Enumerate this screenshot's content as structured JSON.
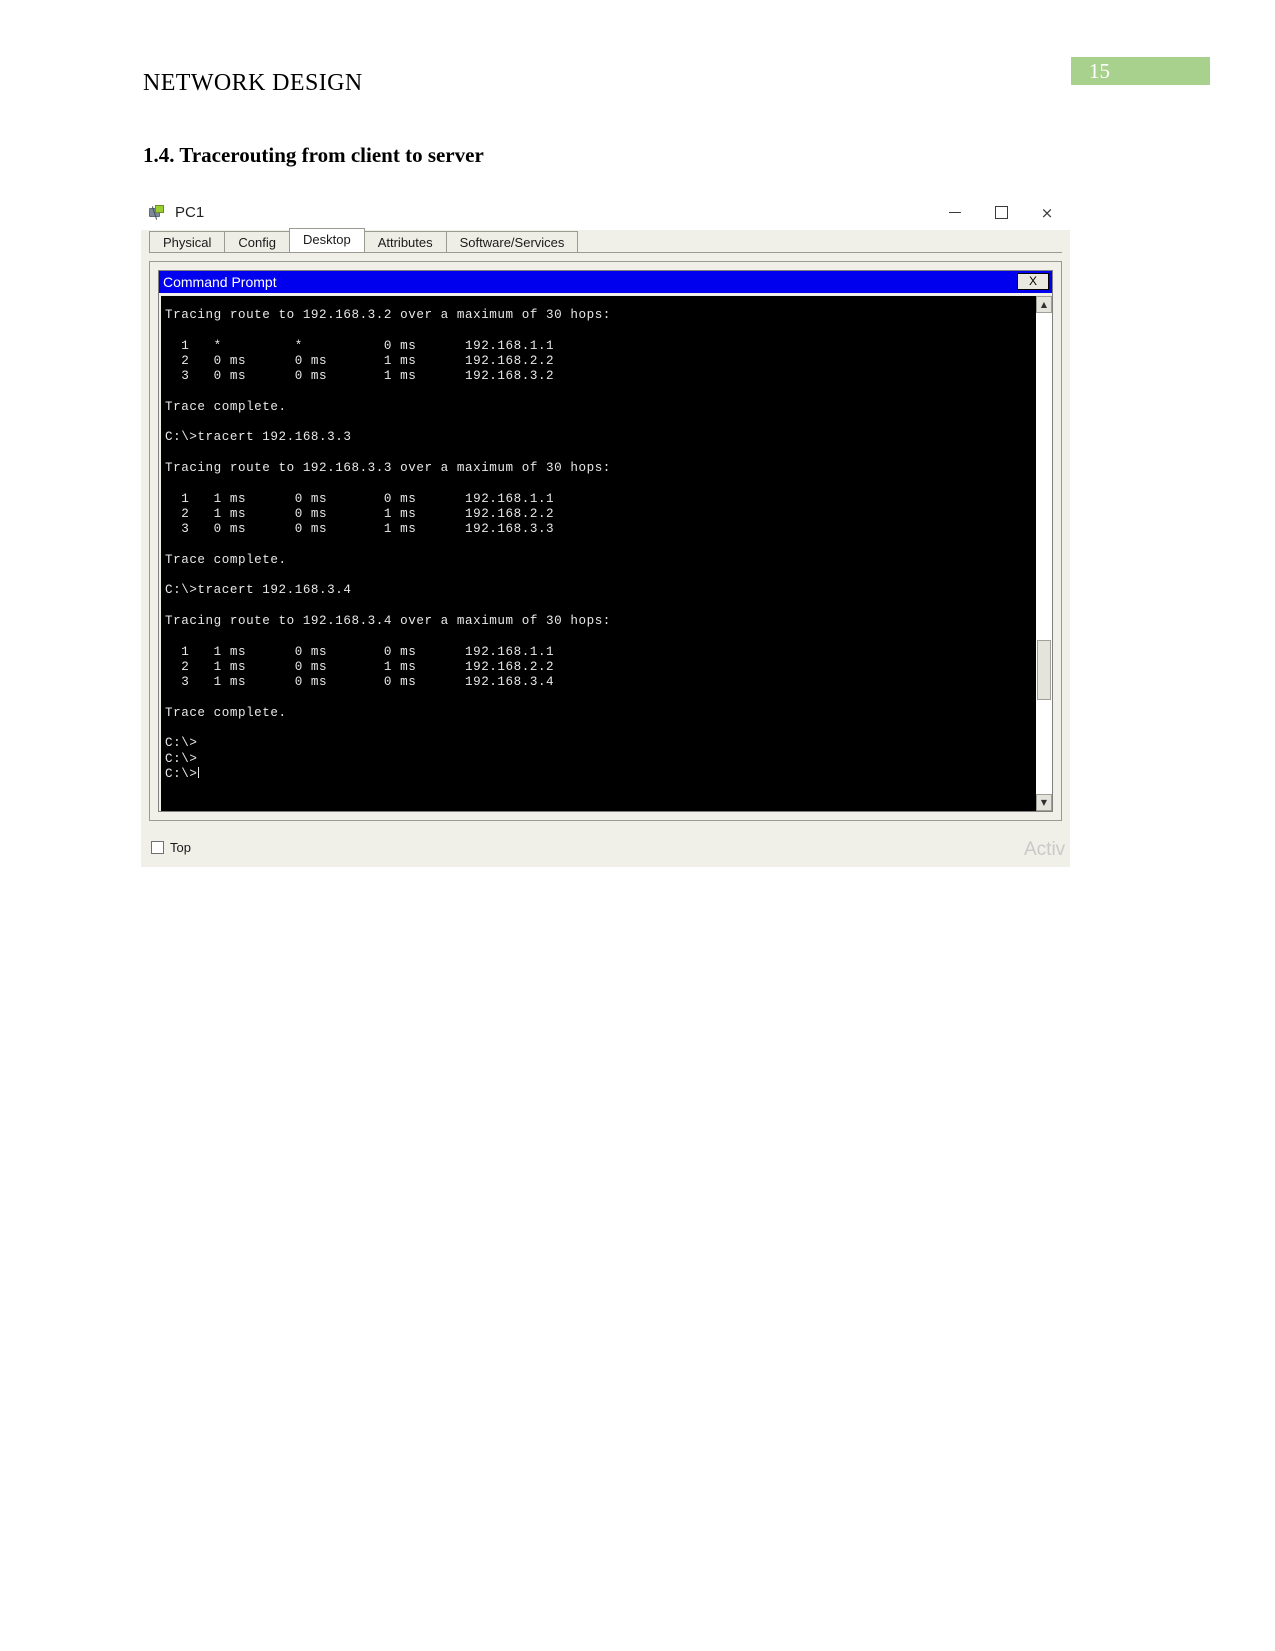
{
  "document": {
    "page_number": "15",
    "running_header": "NETWORK DESIGN",
    "section_heading": "1.4. Tracerouting from client to server",
    "badge_color": "#a9d18e"
  },
  "pt_window": {
    "title": "PC1",
    "device_icon": "pc-device-icon",
    "window_buttons": {
      "minimize": "minimize-icon",
      "maximize": "maximize-icon",
      "close": "×"
    },
    "tabs": [
      {
        "label": "Physical",
        "active": false
      },
      {
        "label": "Config",
        "active": false
      },
      {
        "label": "Desktop",
        "active": true
      },
      {
        "label": "Attributes",
        "active": false
      },
      {
        "label": "Software/Services",
        "active": false
      }
    ],
    "footer": {
      "checkbox_label": "Top",
      "checkbox_checked": false
    },
    "watermark": "Activ"
  },
  "command_prompt": {
    "title": "Command Prompt",
    "close_label": "X",
    "title_bar_color": "#0000ee",
    "background_color": "#000000",
    "text_color": "#e8e8e8",
    "scrollbar": {
      "up_arrow": "▲",
      "down_arrow": "▼",
      "thumb_position_pct": 68
    },
    "lines": [
      "Tracing route to 192.168.3.2 over a maximum of 30 hops:",
      "",
      "  1   *         *          0 ms      192.168.1.1",
      "  2   0 ms      0 ms       1 ms      192.168.2.2",
      "  3   0 ms      0 ms       1 ms      192.168.3.2",
      "",
      "Trace complete.",
      "",
      "C:\\>tracert 192.168.3.3",
      "",
      "Tracing route to 192.168.3.3 over a maximum of 30 hops:",
      "",
      "  1   1 ms      0 ms       0 ms      192.168.1.1",
      "  2   1 ms      0 ms       1 ms      192.168.2.2",
      "  3   0 ms      0 ms       1 ms      192.168.3.3",
      "",
      "Trace complete.",
      "",
      "C:\\>tracert 192.168.3.4",
      "",
      "Tracing route to 192.168.3.4 over a maximum of 30 hops:",
      "",
      "  1   1 ms      0 ms       0 ms      192.168.1.1",
      "  2   1 ms      0 ms       1 ms      192.168.2.2",
      "  3   1 ms      0 ms       0 ms      192.168.3.4",
      "",
      "Trace complete.",
      "",
      "C:\\>",
      "C:\\>",
      "C:\\>"
    ]
  }
}
